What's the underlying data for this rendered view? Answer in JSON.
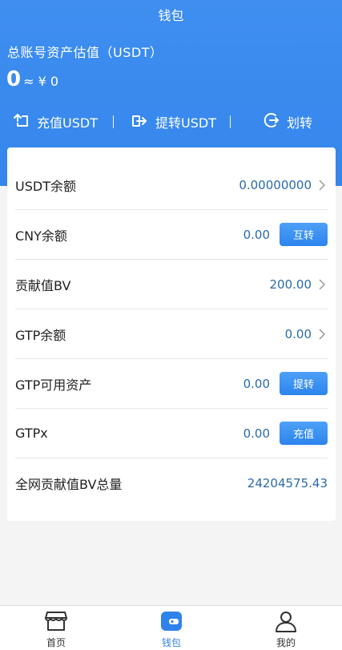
{
  "header": {
    "title": "钱包",
    "asset_label": "总账号资产估值（USDT）",
    "asset_value": "0",
    "asset_approx": "≈ ¥ 0"
  },
  "actions": [
    {
      "label": "充值USDT",
      "icon": "deposit-icon"
    },
    {
      "label": "提转USDT",
      "icon": "withdraw-icon"
    },
    {
      "label": "划转",
      "icon": "transfer-icon"
    }
  ],
  "rows": [
    {
      "label": "USDT余额",
      "value": "0.00000000",
      "action": "chevron"
    },
    {
      "label": "CNY余额",
      "value": "0.00",
      "action": "button",
      "button_label": "互转"
    },
    {
      "label": "贡献值BV",
      "value": "200.00",
      "action": "chevron"
    },
    {
      "label": "GTP余额",
      "value": "0.00",
      "action": "chevron"
    },
    {
      "label": "GTP可用资产",
      "value": "0.00",
      "action": "button",
      "button_label": "提转"
    },
    {
      "label": "GTPx",
      "value": "0.00",
      "action": "button",
      "button_label": "充值"
    },
    {
      "label": "全网贡献值BV总量",
      "value": "24204575.43",
      "action": "none"
    }
  ],
  "tabbar": [
    {
      "label": "首页",
      "icon": "shop-icon",
      "active": false
    },
    {
      "label": "钱包",
      "icon": "wallet-icon",
      "active": true
    },
    {
      "label": "我的",
      "icon": "user-icon",
      "active": false
    }
  ],
  "colors": {
    "accent": "#3586ec",
    "value_text": "#2a6aaa"
  }
}
